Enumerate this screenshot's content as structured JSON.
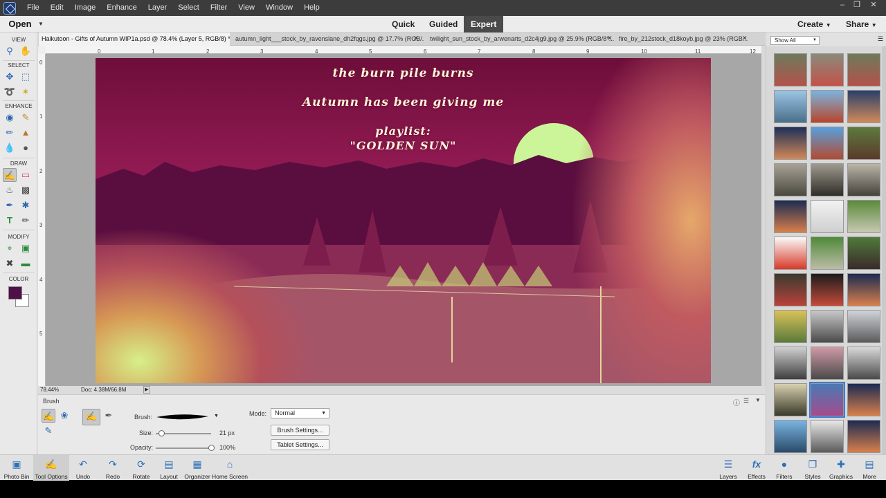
{
  "menubar": {
    "items": [
      "File",
      "Edit",
      "Image",
      "Enhance",
      "Layer",
      "Select",
      "Filter",
      "View",
      "Window",
      "Help"
    ]
  },
  "modebar": {
    "open_label": "Open",
    "modes": [
      "Quick",
      "Guided",
      "Expert"
    ],
    "active_mode": "Expert",
    "create_label": "Create",
    "share_label": "Share"
  },
  "toolbox": {
    "sections": [
      "VIEW",
      "SELECT",
      "ENHANCE",
      "DRAW",
      "MODIFY",
      "COLOR"
    ],
    "foreground_color": "#4f0f48",
    "background_color": "#ffffff"
  },
  "tabs": [
    {
      "label": "Haikutoon - Gifts of Autumn WIP1a.psd @ 78.4% (Layer 5, RGB/8) *"
    },
    {
      "label": "autumn_light___stock_by_ravenslane_dh2fqgs.jpg @ 17.7% (RGB/..."
    },
    {
      "label": "twilight_sun_stock_by_arwenarts_d2c4jg9.jpg @ 25.9% (RGB/8*..."
    },
    {
      "label": "fire_by_212stock_d18koyb.jpg @ 23% (RGB..."
    }
  ],
  "ruler": {
    "h_ticks": [
      "0",
      "1",
      "2",
      "3",
      "4",
      "5",
      "6",
      "7",
      "8",
      "9",
      "10",
      "11",
      "12"
    ],
    "v_ticks": [
      "0",
      "1",
      "2",
      "3",
      "4",
      "5"
    ]
  },
  "artwork": {
    "line1": "the burn pile burns",
    "line2": "Autumn has been giving me",
    "line3": "playlist:",
    "line4": "\"GOLDEN SUN\""
  },
  "status": {
    "zoom": "78.44%",
    "doc": "Doc: 4.38M/66.8M"
  },
  "options": {
    "panel_title": "Brush",
    "brush_label": "Brush:",
    "size_label": "Size:",
    "size_value": "21 px",
    "size_fraction": 0.1,
    "opacity_label": "Opacity:",
    "opacity_value": "100%",
    "opacity_fraction": 1.0,
    "mode_label": "Mode:",
    "mode_value": "Normal",
    "brush_settings": "Brush Settings...",
    "tablet_settings": "Tablet Settings..."
  },
  "bin": {
    "filter_value": "Show All"
  },
  "taskbar": {
    "left": [
      "Photo Bin",
      "Tool Options",
      "Undo",
      "Redo",
      "Rotate",
      "Layout",
      "Organizer",
      "Home Screen"
    ],
    "right": [
      "Layers",
      "Effects",
      "Filters",
      "Styles",
      "Graphics",
      "More"
    ]
  }
}
